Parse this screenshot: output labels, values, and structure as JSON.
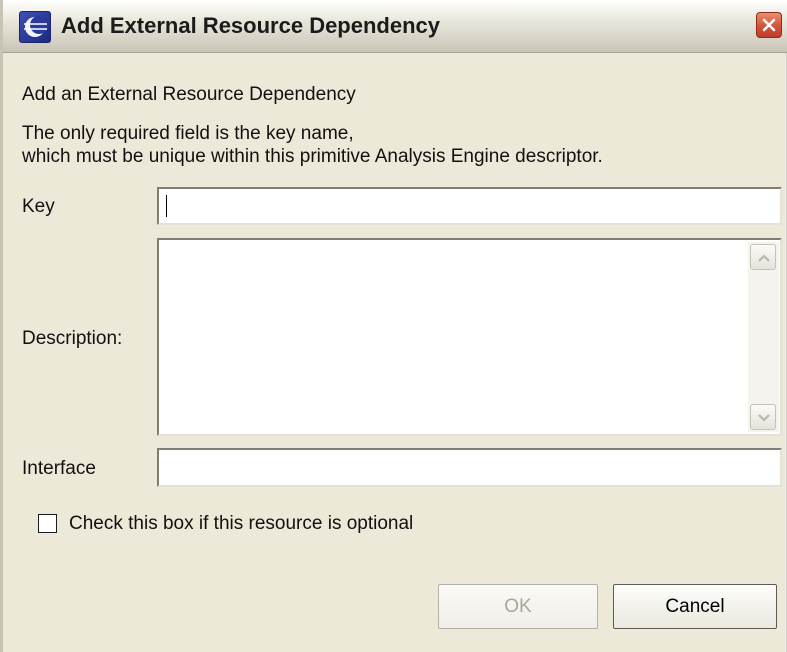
{
  "window": {
    "title": "Add External Resource Dependency",
    "icon": "eclipse-app-icon",
    "close_icon": "close-icon"
  },
  "content": {
    "heading": "Add an External Resource Dependency",
    "instruction_line1": "The only required field is the key name,",
    "instruction_line2": "which must be unique within this primitive Analysis Engine descriptor."
  },
  "form": {
    "key": {
      "label": "Key",
      "value": ""
    },
    "description": {
      "label": "Description:",
      "value": ""
    },
    "interface": {
      "label": "Interface",
      "value": ""
    },
    "optional": {
      "label": "Check this box if this resource is optional",
      "checked": false
    }
  },
  "buttons": {
    "ok_label": "OK",
    "ok_enabled": false,
    "cancel_label": "Cancel"
  },
  "colors": {
    "dialog_bg": "#ece9d8",
    "close_button": "#d3533b"
  }
}
